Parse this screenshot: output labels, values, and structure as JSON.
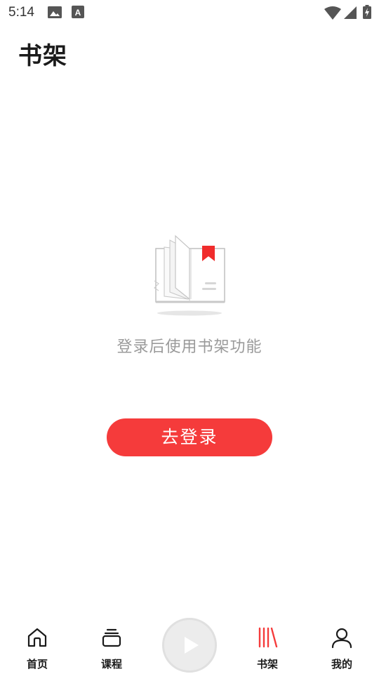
{
  "status_bar": {
    "time": "5:14",
    "icons": [
      "image-icon",
      "font-download-icon",
      "wifi-icon",
      "signal-icon",
      "battery-charging-icon"
    ]
  },
  "header": {
    "title": "书架"
  },
  "empty_state": {
    "illustration": "open-book-bookmark-icon",
    "message": "登录后使用书架功能",
    "button_label": "去登录"
  },
  "bottom_nav": {
    "items": [
      {
        "label": "首页",
        "icon": "home-icon",
        "active": false
      },
      {
        "label": "课程",
        "icon": "courses-stack-icon",
        "active": false
      },
      {
        "label": "书架",
        "icon": "bookshelf-icon",
        "active": true
      },
      {
        "label": "我的",
        "icon": "person-icon",
        "active": false
      }
    ],
    "center_button_icon": "play-icon"
  },
  "colors": {
    "accent": "#f53b3b",
    "muted_text": "#9a9a9a",
    "play_circle": "#ececec"
  }
}
